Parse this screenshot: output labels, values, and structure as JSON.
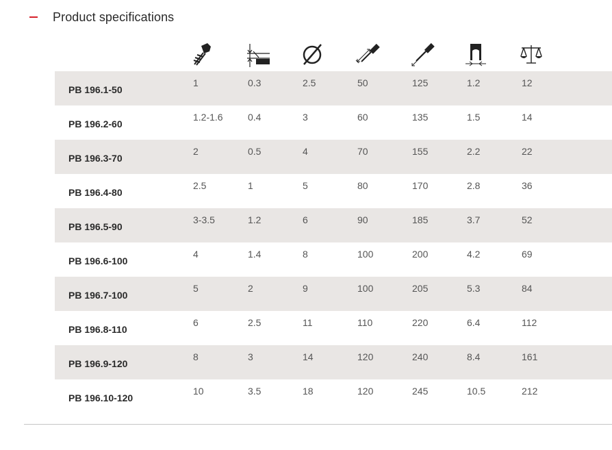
{
  "section": {
    "title": "Product specifications",
    "collapse_icon": "minus-dash-icon",
    "accent_color": "#d6202a"
  },
  "columns": [
    {
      "key": "screw",
      "icon": "screw-icon"
    },
    {
      "key": "slot_thickness",
      "icon": "blade-thickness-icon"
    },
    {
      "key": "diameter",
      "icon": "diameter-icon"
    },
    {
      "key": "blade_length",
      "icon": "blade-length-icon"
    },
    {
      "key": "total_length",
      "icon": "total-length-icon"
    },
    {
      "key": "blade_width",
      "icon": "blade-width-icon"
    },
    {
      "key": "weight",
      "icon": "scale-weight-icon"
    }
  ],
  "rows": [
    {
      "model": "PB 196.1-50",
      "values": [
        "1",
        "0.3",
        "2.5",
        "50",
        "125",
        "1.2",
        "12"
      ]
    },
    {
      "model": "PB 196.2-60",
      "values": [
        "1.2-1.6",
        "0.4",
        "3",
        "60",
        "135",
        "1.5",
        "14"
      ]
    },
    {
      "model": "PB 196.3-70",
      "values": [
        "2",
        "0.5",
        "4",
        "70",
        "155",
        "2.2",
        "22"
      ]
    },
    {
      "model": "PB 196.4-80",
      "values": [
        "2.5",
        "1",
        "5",
        "80",
        "170",
        "2.8",
        "36"
      ]
    },
    {
      "model": "PB 196.5-90",
      "values": [
        "3-3.5",
        "1.2",
        "6",
        "90",
        "185",
        "3.7",
        "52"
      ]
    },
    {
      "model": "PB 196.6-100",
      "values": [
        "4",
        "1.4",
        "8",
        "100",
        "200",
        "4.2",
        "69"
      ]
    },
    {
      "model": "PB 196.7-100",
      "values": [
        "5",
        "2",
        "9",
        "100",
        "205",
        "5.3",
        "84"
      ]
    },
    {
      "model": "PB 196.8-110",
      "values": [
        "6",
        "2.5",
        "11",
        "110",
        "220",
        "6.4",
        "112"
      ]
    },
    {
      "model": "PB 196.9-120",
      "values": [
        "8",
        "3",
        "14",
        "120",
        "240",
        "8.4",
        "161"
      ]
    },
    {
      "model": "PB 196.10-120",
      "values": [
        "10",
        "3.5",
        "18",
        "120",
        "245",
        "10.5",
        "212"
      ]
    }
  ],
  "colors": {
    "row_shade": "#e9e6e4",
    "text": "#555555",
    "model_text": "#2a2a2a",
    "rule": "#c4c4c4"
  }
}
